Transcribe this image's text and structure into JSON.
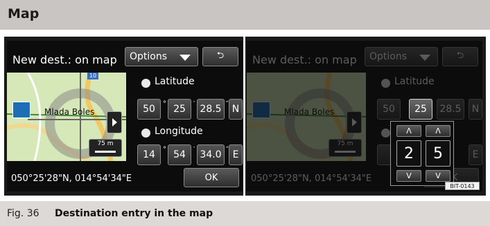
{
  "header": {
    "title": "Map"
  },
  "screens": {
    "title": "New dest.: on map",
    "options_label": "Options",
    "back_glyph": "⮌",
    "city": "Mlada Boles",
    "road_number": "10",
    "scale": "75 m",
    "latitude": {
      "label": "Latitude",
      "deg": "50",
      "min": "25",
      "sec": "28.5",
      "hemi": "N"
    },
    "longitude": {
      "label": "Longitude",
      "deg": "14",
      "min": "54",
      "sec": "34.0",
      "hemi": "E"
    },
    "units": {
      "deg": "°",
      "min": "′",
      "sec": "″"
    },
    "coord_readout": "050°25'28\"N, 014°54'34\"E",
    "ok_label": "OK"
  },
  "spinner": {
    "up": "Λ",
    "down": "V",
    "digit1": "2",
    "digit2": "5"
  },
  "figure_id": "BIT-0143",
  "caption": {
    "prefix": "Fig. 36",
    "text": "Destination entry in the map"
  },
  "icons": [
    "back-arrow-icon",
    "dropdown-arrow-icon",
    "globe-icon",
    "navigation-icon",
    "position-marker-icon",
    "map-expand-icon"
  ],
  "colors": {
    "header": "#c8c5c2",
    "caption": "#dcd9d6",
    "screen_bg": "#0c0c0c",
    "map_green": "#cfe3b0"
  }
}
